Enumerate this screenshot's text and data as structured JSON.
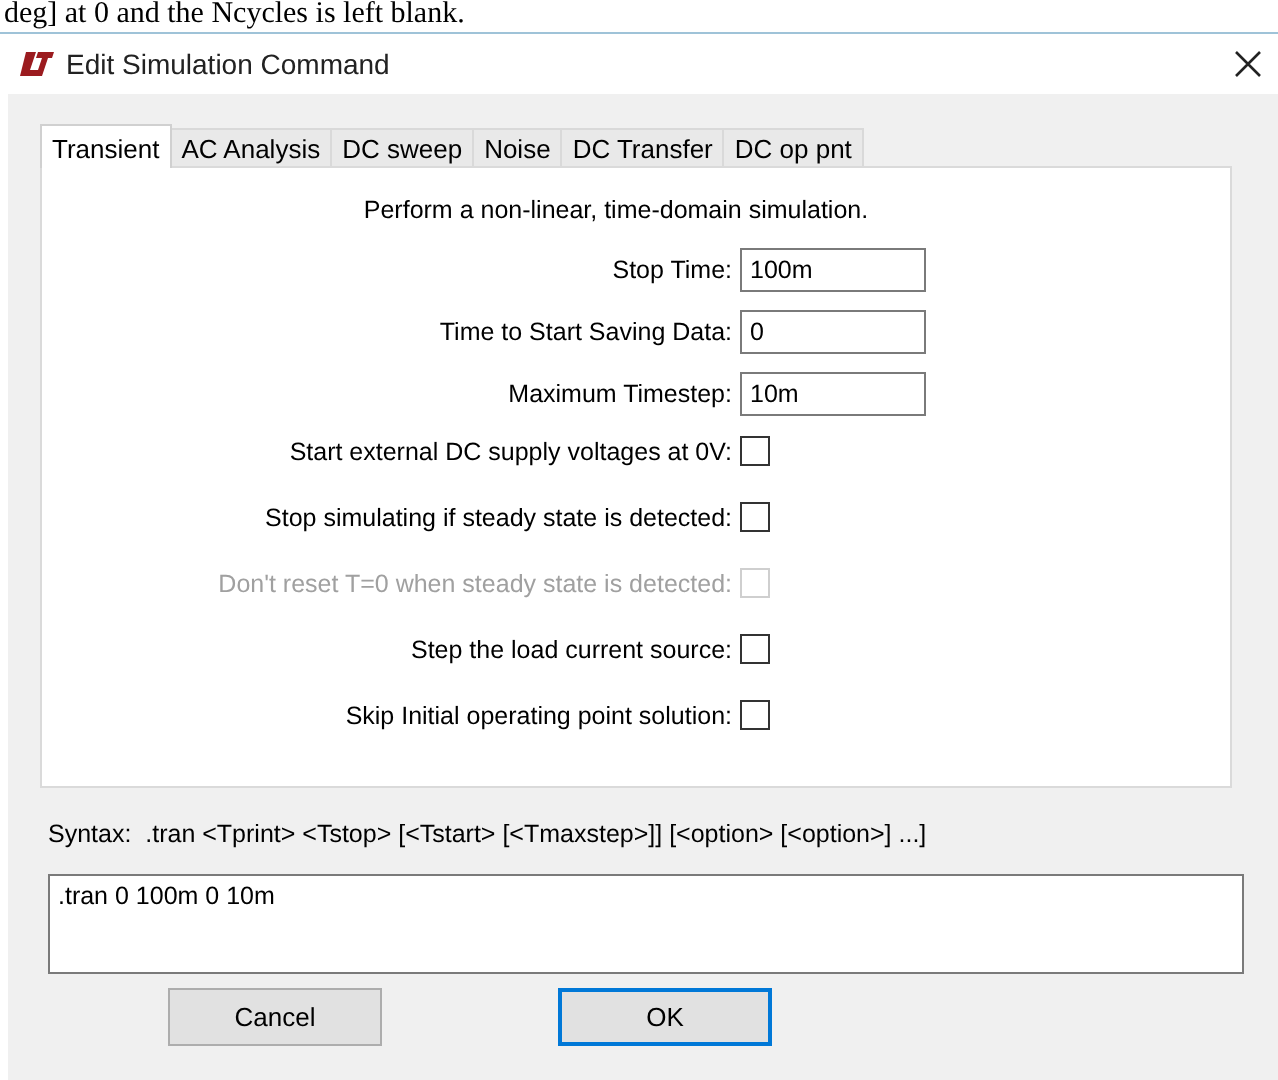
{
  "background_text": "deg] at 0 and the Ncycles is left blank.",
  "window": {
    "title": "Edit Simulation Command"
  },
  "tabs": [
    {
      "label": "Transient",
      "selected": true
    },
    {
      "label": "AC Analysis",
      "selected": false
    },
    {
      "label": "DC sweep",
      "selected": false
    },
    {
      "label": "Noise",
      "selected": false
    },
    {
      "label": "DC Transfer",
      "selected": false
    },
    {
      "label": "DC op pnt",
      "selected": false
    }
  ],
  "description": "Perform a non-linear, time-domain simulation.",
  "fields": [
    {
      "label": "Stop Time:",
      "value": "100m"
    },
    {
      "label": "Time to Start Saving Data:",
      "value": "0"
    },
    {
      "label": "Maximum Timestep:",
      "value": "10m"
    }
  ],
  "options": [
    {
      "label": "Start external DC supply voltages at 0V:",
      "checked": false,
      "disabled": false
    },
    {
      "label": "Stop simulating if steady state is detected:",
      "checked": false,
      "disabled": false
    },
    {
      "label": "Don't reset T=0 when steady state is detected:",
      "checked": false,
      "disabled": true
    },
    {
      "label": "Step the load current source:",
      "checked": false,
      "disabled": false
    },
    {
      "label": "Skip Initial operating point solution:",
      "checked": false,
      "disabled": false
    }
  ],
  "syntax": "Syntax:  .tran <Tprint> <Tstop> [<Tstart> [<Tmaxstep>]] [<option> [<option>] ...]",
  "command": ".tran 0 100m 0 10m",
  "buttons": [
    {
      "label": "Cancel",
      "default": false
    },
    {
      "label": "OK",
      "default": true
    }
  ]
}
